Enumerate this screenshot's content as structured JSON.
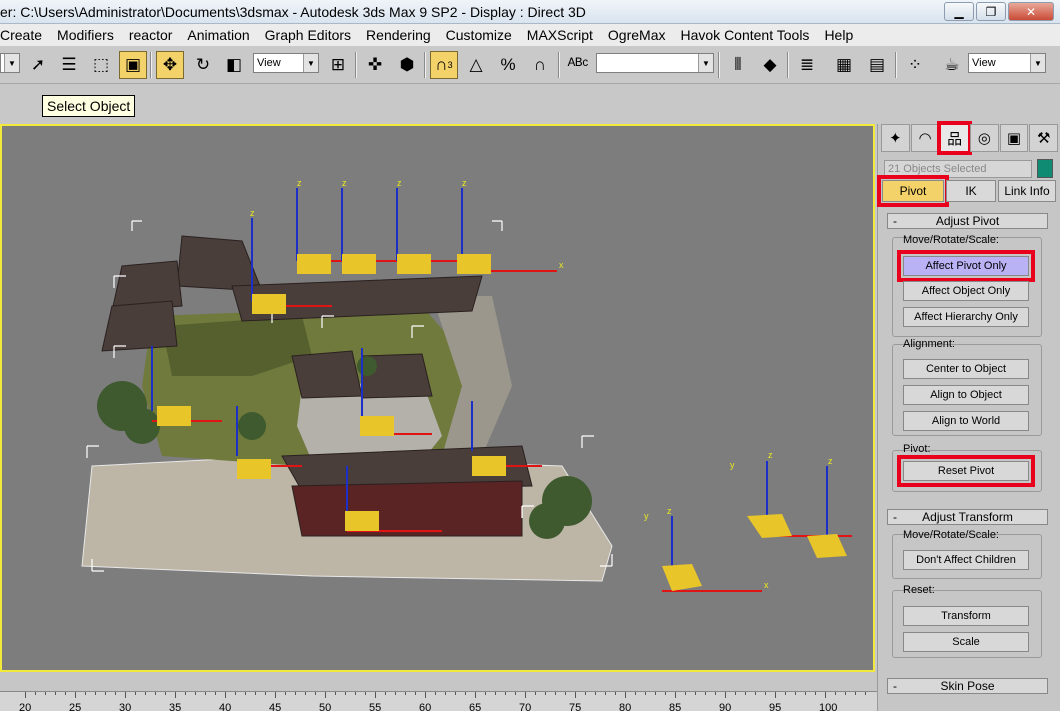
{
  "window": {
    "title": "er: C:\\Users\\Administrator\\Documents\\3dsmax      - Autodesk 3ds Max 9 SP2      - Display : Direct 3D",
    "minimize": "▁",
    "restore": "❐",
    "close": "✕"
  },
  "menu": [
    "Create",
    "Modifiers",
    "reactor",
    "Animation",
    "Graph Editors",
    "Rendering",
    "Customize",
    "MAXScript",
    "OgreMax",
    "Havok Content Tools",
    "Help"
  ],
  "toolbar": {
    "ref_coord_value": "View",
    "view_dropdown_value": "View",
    "named_selection_value": "",
    "snap_number": "3"
  },
  "tooltip": "Select Object",
  "panel": {
    "selection_count": "21 Objects Selected",
    "subtabs": {
      "pivot": "Pivot",
      "ik": "IK",
      "link_info": "Link Info"
    },
    "adjust_pivot": {
      "title": "Adjust Pivot",
      "move_label": "Move/Rotate/Scale:",
      "affect_pivot_only": "Affect Pivot Only",
      "affect_object_only": "Affect Object Only",
      "affect_hierarchy_only": "Affect Hierarchy Only",
      "alignment_label": "Alignment:",
      "center_to_object": "Center to Object",
      "align_to_object": "Align to Object",
      "align_to_world": "Align to World",
      "pivot_label": "Pivot:",
      "reset_pivot": "Reset Pivot"
    },
    "adjust_transform": {
      "title": "Adjust Transform",
      "move_label": "Move/Rotate/Scale:",
      "dont_affect_children": "Don't Affect Children",
      "reset_label": "Reset:",
      "transform": "Transform",
      "scale": "Scale"
    },
    "skin_pose": {
      "title": "Skin Pose"
    }
  },
  "timeline": {
    "ticks": [
      "20",
      "25",
      "30",
      "35",
      "40",
      "45",
      "50",
      "55",
      "60",
      "65",
      "70",
      "75",
      "80",
      "85",
      "90",
      "95",
      "100"
    ]
  },
  "gizmo_labels": {
    "x": "x",
    "y": "y",
    "z": "z"
  },
  "colors": {
    "viewport_border": "#f3e93a",
    "highlight_red": "#e8001c",
    "active_button": "#f4d26a",
    "pivot_button": "#b9b3f5"
  }
}
